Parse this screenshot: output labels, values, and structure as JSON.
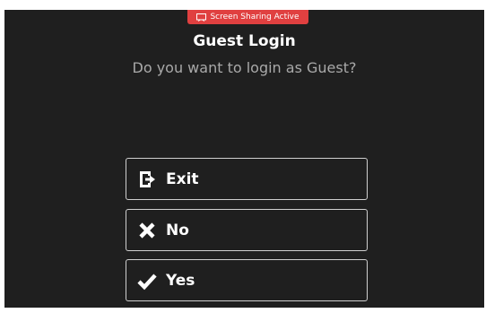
{
  "banner": {
    "text": "Screen Sharing Active",
    "color": "#e04040",
    "icon": "screen-share-icon"
  },
  "dialog": {
    "title": "Guest Login",
    "message": "Do you want to login as Guest?"
  },
  "buttons": [
    {
      "label": "Exit",
      "icon": "exit-icon"
    },
    {
      "label": "No",
      "icon": "x-icon"
    },
    {
      "label": "Yes",
      "icon": "checkmark-icon"
    }
  ]
}
